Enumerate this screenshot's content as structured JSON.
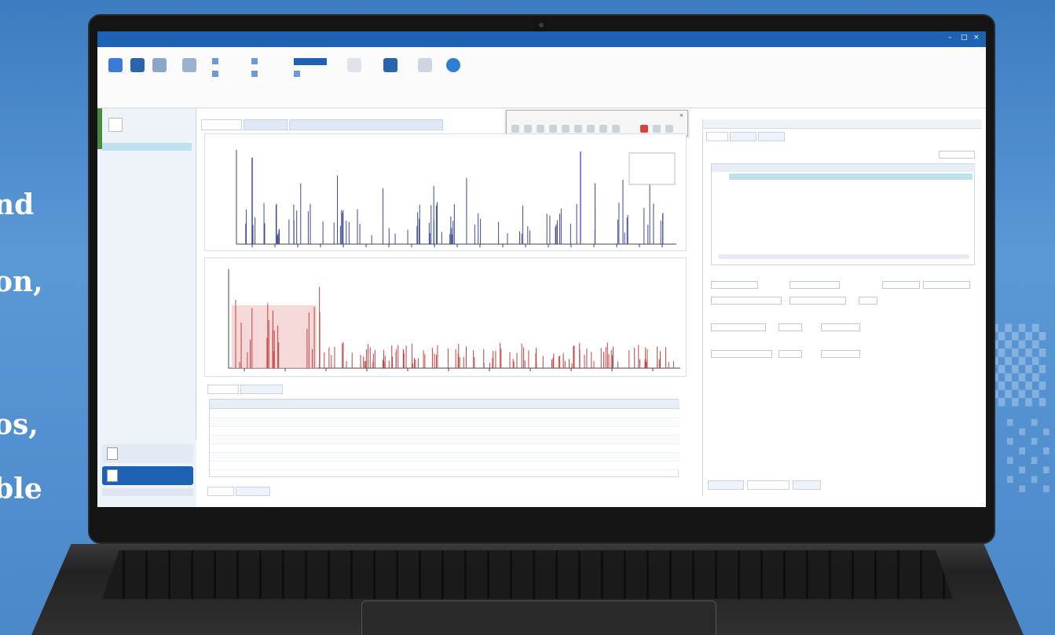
{
  "page": {
    "left_text_lines": [
      "nd",
      "on,",
      "os,",
      "ble"
    ]
  },
  "app": {
    "ribbon": {
      "tab_label": "",
      "big_buttons": [
        {
          "icon": "file-icon"
        },
        {
          "icon": "chart-icon"
        },
        {
          "icon": "database-icon"
        },
        {
          "icon": "grid-icon"
        },
        {
          "icon": "doc-icon"
        },
        {
          "icon": "tools-icon"
        },
        {
          "icon": "search-icon"
        },
        {
          "icon": "help-icon"
        }
      ]
    },
    "left_nav": {
      "items": [
        {
          "icon": "folder-icon"
        },
        {
          "icon": "document-icon"
        }
      ]
    },
    "float_toolbar": {
      "title": ""
    },
    "spectrum_top": {
      "x_ticks": [
        "",
        "",
        "",
        "",
        "",
        "",
        "",
        "",
        "",
        "",
        "",
        "",
        "",
        "",
        "",
        "",
        "",
        "",
        ""
      ],
      "peak_color": "#3c4a9c"
    },
    "spectrum_bottom": {
      "peak_color": "#c44040",
      "fill_color": "#f1c8c8"
    },
    "table": {
      "columns": [
        "",
        "",
        "",
        "",
        "",
        "",
        "",
        "",
        "",
        ""
      ],
      "row_count": 7
    },
    "right_panel": {
      "sections": [
        "",
        "",
        ""
      ]
    },
    "colors": {
      "accent": "#1e62b4",
      "selection": "#bfe0ee"
    }
  }
}
